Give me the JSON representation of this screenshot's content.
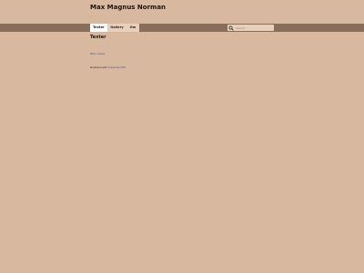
{
  "header": {
    "site_title": "Max Magnus Norman",
    "tagline": "..."
  },
  "nav": {
    "items": [
      {
        "label": "Texter",
        "active": true
      },
      {
        "label": "Gallery",
        "active": false
      },
      {
        "label": "Om",
        "active": false
      }
    ]
  },
  "search": {
    "placeholder": "Search",
    "icon": "search-icon"
  },
  "main": {
    "heading": "Texter",
    "link_text": "BSV / Kone"
  },
  "footer": {
    "prefix": "Published with",
    "link_text": "Grayscale CMS"
  },
  "colors": {
    "background": "#d8b99f",
    "nav_bar": "#8a6e5c",
    "nav_item": "#e7d1bd",
    "nav_item_active": "#ffffff",
    "link": "#3d5a8a"
  }
}
